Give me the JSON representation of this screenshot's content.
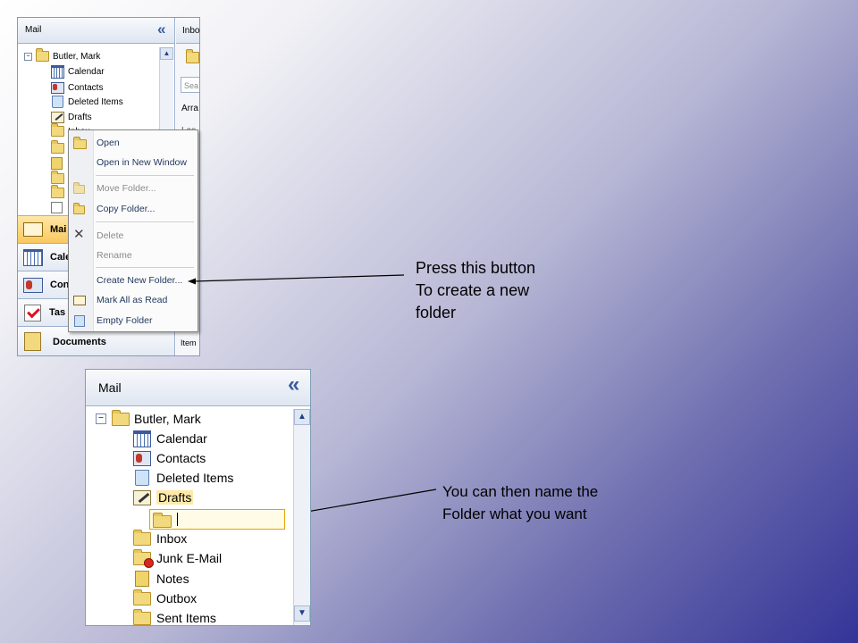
{
  "top_panel": {
    "header_title": "Mail",
    "collapse_glyph": "«",
    "right_pane": {
      "tab_label": "Inbo",
      "search_placeholder": "Sea",
      "arrange_label": "Arra",
      "last_label": "Las",
      "items_label": "Item"
    },
    "tree": {
      "root": "Butler, Mark",
      "items": [
        {
          "label": "Calendar",
          "icon": "calendar-icon"
        },
        {
          "label": "Contacts",
          "icon": "contacts-icon"
        },
        {
          "label": "Deleted Items",
          "icon": "deleted-items-icon"
        },
        {
          "label": "Drafts",
          "icon": "drafts-icon"
        },
        {
          "label": "Inbox",
          "icon": "inbox-icon"
        }
      ]
    },
    "nav_buttons": [
      {
        "label": "Mai",
        "icon": "mail-icon"
      },
      {
        "label": "Cale",
        "icon": "calendar-icon"
      },
      {
        "label": "Con",
        "icon": "contacts-icon"
      },
      {
        "label": "Tas",
        "icon": "tasks-icon"
      },
      {
        "label": "Documents",
        "icon": "documents-icon"
      }
    ]
  },
  "context_menu": {
    "items": [
      {
        "label": "Open",
        "enabled": true
      },
      {
        "label": "Open in New Window",
        "enabled": true
      },
      {
        "label": "Move Folder...",
        "enabled": false
      },
      {
        "label": "Copy Folder...",
        "enabled": true
      },
      {
        "label": "Delete",
        "enabled": false
      },
      {
        "label": "Rename",
        "enabled": false
      },
      {
        "label": "Create New Folder...",
        "enabled": true
      },
      {
        "label": "Mark All as Read",
        "enabled": true
      },
      {
        "label": "Empty Folder",
        "enabled": true
      }
    ]
  },
  "bottom_panel": {
    "header_title": "Mail",
    "collapse_glyph": "«",
    "tree": {
      "root": "Butler, Mark",
      "items": [
        {
          "label": "Calendar",
          "icon": "calendar-icon"
        },
        {
          "label": "Contacts",
          "icon": "contacts-icon"
        },
        {
          "label": "Deleted Items",
          "icon": "deleted-items-icon"
        },
        {
          "label": "Drafts",
          "icon": "drafts-icon"
        },
        {
          "label": "",
          "icon": "new-folder-icon"
        },
        {
          "label": "Inbox",
          "icon": "inbox-icon"
        },
        {
          "label": "Junk E-Mail",
          "icon": "junk-email-icon"
        },
        {
          "label": "Notes",
          "icon": "notes-icon"
        },
        {
          "label": "Outbox",
          "icon": "outbox-icon"
        },
        {
          "label": "Sent Items",
          "icon": "sent-items-icon"
        }
      ]
    },
    "new_folder_value": ""
  },
  "callouts": {
    "first": [
      "Press this button",
      "To create a new",
      "folder"
    ],
    "second": [
      "You can then name the",
      "Folder what you want"
    ]
  },
  "colors": {
    "accent": "#3b5b9c",
    "selection": "#ffe9a8",
    "edit_border": "#e2a400"
  }
}
